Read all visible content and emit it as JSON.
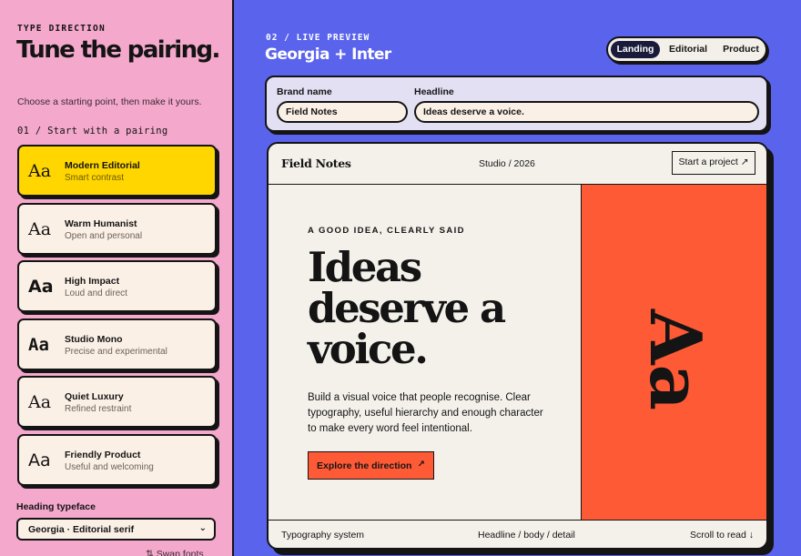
{
  "sidebar": {
    "eyebrow": "TYPE DIRECTION",
    "title": "Tune the pairing.",
    "subtitle": "Choose a starting point, then make it yours.",
    "step_label": "01 / Start with a pairing",
    "pairings": [
      {
        "sample": "Aa",
        "name": "Modern Editorial",
        "desc": "Smart contrast",
        "active": true
      },
      {
        "sample": "Aa",
        "name": "Warm Humanist",
        "desc": "Open and personal"
      },
      {
        "sample": "Aa",
        "name": "High Impact",
        "desc": "Loud and direct"
      },
      {
        "sample": "Aa",
        "name": "Studio Mono",
        "desc": "Precise and experimental"
      },
      {
        "sample": "Aa",
        "name": "Quiet Luxury",
        "desc": "Refined restraint"
      },
      {
        "sample": "Aa",
        "name": "Friendly Product",
        "desc": "Useful and welcoming"
      }
    ],
    "heading_label": "Heading typeface",
    "heading_select": "Georgia · Editorial serif",
    "swap_label": "⇅ Swap fonts"
  },
  "main": {
    "eyebrow": "02 / LIVE PREVIEW",
    "title": "Georgia + Inter",
    "tabs": [
      {
        "label": "Landing",
        "active": true
      },
      {
        "label": "Editorial"
      },
      {
        "label": "Product"
      }
    ],
    "brand_label": "Brand name",
    "brand_value": "Field Notes",
    "headline_label": "Headline",
    "headline_value": "Ideas deserve a voice."
  },
  "preview": {
    "brand": "Field Notes",
    "studio": "Studio / 2026",
    "cta": "Start a project ↗",
    "kicker": "A GOOD IDEA, CLEARLY SAID",
    "headline": "Ideas deserve a voice.",
    "body": "Build a visual voice that people recognise. Clear typography, useful hierarchy and enough character to make every word feel intentional.",
    "button": "Explore the direction",
    "button_arrow": "↗",
    "sample": "Aa",
    "footer_left": "Typography system",
    "footer_mid": "Headline / body / detail",
    "footer_right": "Scroll to read ↓"
  },
  "colors": {
    "sidebar_bg": "#f3a8cc",
    "main_bg": "#5a63ec",
    "active_card": "#ffd600",
    "accent": "#ff5a36",
    "ink": "#141414"
  }
}
